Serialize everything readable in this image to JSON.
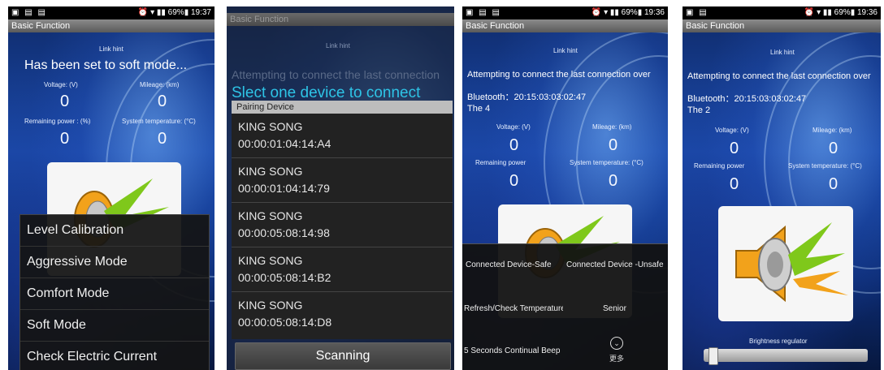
{
  "status": {
    "time1": "19:37",
    "time3": "19:36",
    "time4": "19:36",
    "battery": "69%"
  },
  "title": "Basic Function",
  "link_hint": "Link hint",
  "screen1": {
    "mode_msg": "Has been set to soft mode...",
    "voltage_label": "Voltage: (V)",
    "mileage_label": "Mileage: (km)",
    "voltage_value": "0",
    "mileage_value": "0",
    "power_label": "Remaining power : (%)",
    "temp_label": "System temperature: (°C)",
    "power_value": "0",
    "temp_value": "0",
    "menu": [
      "Level Calibration",
      "Aggressive Mode",
      "Comfort Mode",
      "Soft Mode",
      "Check Electric Current"
    ]
  },
  "screen2": {
    "attempt_msg": "Attempting to connect the last connection",
    "select_title": "Slect one device to connect",
    "pairing_header": "Pairing Device",
    "devices": [
      {
        "name": "KING SONG",
        "mac": "00:00:01:04:14:A4"
      },
      {
        "name": "KING SONG",
        "mac": "00:00:01:04:14:79"
      },
      {
        "name": "KING SONG",
        "mac": "00:00:05:08:14:98"
      },
      {
        "name": "KING SONG",
        "mac": "00:00:05:08:14:B2"
      },
      {
        "name": "KING SONG",
        "mac": "00:00:05:08:14:D8"
      }
    ],
    "scan_button": "Scanning"
  },
  "screen3": {
    "attempt_msg": "Attempting to connect the last connection over",
    "bt_line": "Bluetooth：20:15:03:03:02:47",
    "the_line": "The 4",
    "voltage_label": "Voltage: (V)",
    "mileage_label": "Mileage: (km)",
    "voltage_value": "0",
    "mileage_value": "0",
    "power_label": "Remaining power",
    "temp_label": "System temperature: (°C)",
    "power_value": "0",
    "temp_value": "0",
    "options": {
      "c1": "Connected Device-Safe",
      "c2": "Connected Device -Unsafe",
      "c3": "Refresh/Check Temperature",
      "c4": "Senior",
      "c5": "5 Seconds Continual Beep",
      "more": "更多"
    }
  },
  "screen4": {
    "attempt_msg": "Attempting to connect the last connection over",
    "bt_line": "Bluetooth：20:15:03:03:02:47",
    "the_line": "The 2",
    "voltage_label": "Voltage: (V)",
    "mileage_label": "Mileage: (km)",
    "voltage_value": "0",
    "mileage_value": "0",
    "power_label": "Remaining power",
    "temp_label": "System temperature: (°C)",
    "power_value": "0",
    "temp_value": "0",
    "brightness_label": "Brightness regulator",
    "brightness_level": 0.02
  }
}
